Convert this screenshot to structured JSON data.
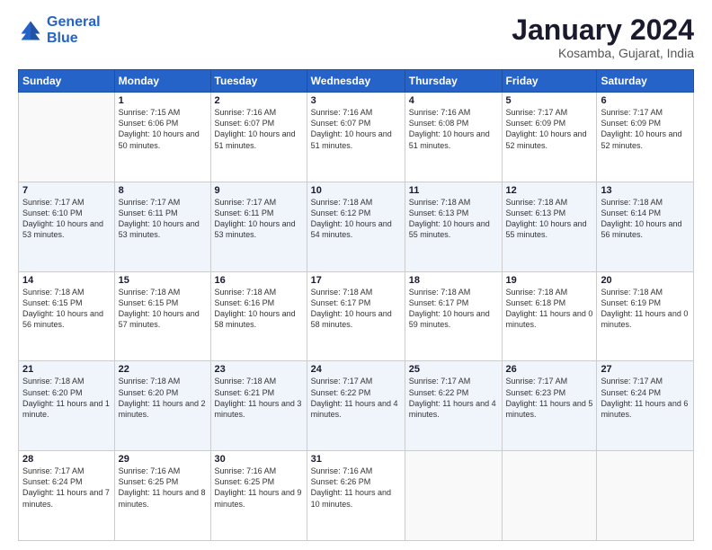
{
  "header": {
    "logo_line1": "General",
    "logo_line2": "Blue",
    "title": "January 2024",
    "location": "Kosamba, Gujarat, India"
  },
  "days_of_week": [
    "Sunday",
    "Monday",
    "Tuesday",
    "Wednesday",
    "Thursday",
    "Friday",
    "Saturday"
  ],
  "weeks": [
    [
      {
        "day": "",
        "sunrise": "",
        "sunset": "",
        "daylight": ""
      },
      {
        "day": "1",
        "sunrise": "Sunrise: 7:15 AM",
        "sunset": "Sunset: 6:06 PM",
        "daylight": "Daylight: 10 hours and 50 minutes."
      },
      {
        "day": "2",
        "sunrise": "Sunrise: 7:16 AM",
        "sunset": "Sunset: 6:07 PM",
        "daylight": "Daylight: 10 hours and 51 minutes."
      },
      {
        "day": "3",
        "sunrise": "Sunrise: 7:16 AM",
        "sunset": "Sunset: 6:07 PM",
        "daylight": "Daylight: 10 hours and 51 minutes."
      },
      {
        "day": "4",
        "sunrise": "Sunrise: 7:16 AM",
        "sunset": "Sunset: 6:08 PM",
        "daylight": "Daylight: 10 hours and 51 minutes."
      },
      {
        "day": "5",
        "sunrise": "Sunrise: 7:17 AM",
        "sunset": "Sunset: 6:09 PM",
        "daylight": "Daylight: 10 hours and 52 minutes."
      },
      {
        "day": "6",
        "sunrise": "Sunrise: 7:17 AM",
        "sunset": "Sunset: 6:09 PM",
        "daylight": "Daylight: 10 hours and 52 minutes."
      }
    ],
    [
      {
        "day": "7",
        "sunrise": "Sunrise: 7:17 AM",
        "sunset": "Sunset: 6:10 PM",
        "daylight": "Daylight: 10 hours and 53 minutes."
      },
      {
        "day": "8",
        "sunrise": "Sunrise: 7:17 AM",
        "sunset": "Sunset: 6:11 PM",
        "daylight": "Daylight: 10 hours and 53 minutes."
      },
      {
        "day": "9",
        "sunrise": "Sunrise: 7:17 AM",
        "sunset": "Sunset: 6:11 PM",
        "daylight": "Daylight: 10 hours and 53 minutes."
      },
      {
        "day": "10",
        "sunrise": "Sunrise: 7:18 AM",
        "sunset": "Sunset: 6:12 PM",
        "daylight": "Daylight: 10 hours and 54 minutes."
      },
      {
        "day": "11",
        "sunrise": "Sunrise: 7:18 AM",
        "sunset": "Sunset: 6:13 PM",
        "daylight": "Daylight: 10 hours and 55 minutes."
      },
      {
        "day": "12",
        "sunrise": "Sunrise: 7:18 AM",
        "sunset": "Sunset: 6:13 PM",
        "daylight": "Daylight: 10 hours and 55 minutes."
      },
      {
        "day": "13",
        "sunrise": "Sunrise: 7:18 AM",
        "sunset": "Sunset: 6:14 PM",
        "daylight": "Daylight: 10 hours and 56 minutes."
      }
    ],
    [
      {
        "day": "14",
        "sunrise": "Sunrise: 7:18 AM",
        "sunset": "Sunset: 6:15 PM",
        "daylight": "Daylight: 10 hours and 56 minutes."
      },
      {
        "day": "15",
        "sunrise": "Sunrise: 7:18 AM",
        "sunset": "Sunset: 6:15 PM",
        "daylight": "Daylight: 10 hours and 57 minutes."
      },
      {
        "day": "16",
        "sunrise": "Sunrise: 7:18 AM",
        "sunset": "Sunset: 6:16 PM",
        "daylight": "Daylight: 10 hours and 58 minutes."
      },
      {
        "day": "17",
        "sunrise": "Sunrise: 7:18 AM",
        "sunset": "Sunset: 6:17 PM",
        "daylight": "Daylight: 10 hours and 58 minutes."
      },
      {
        "day": "18",
        "sunrise": "Sunrise: 7:18 AM",
        "sunset": "Sunset: 6:17 PM",
        "daylight": "Daylight: 10 hours and 59 minutes."
      },
      {
        "day": "19",
        "sunrise": "Sunrise: 7:18 AM",
        "sunset": "Sunset: 6:18 PM",
        "daylight": "Daylight: 11 hours and 0 minutes."
      },
      {
        "day": "20",
        "sunrise": "Sunrise: 7:18 AM",
        "sunset": "Sunset: 6:19 PM",
        "daylight": "Daylight: 11 hours and 0 minutes."
      }
    ],
    [
      {
        "day": "21",
        "sunrise": "Sunrise: 7:18 AM",
        "sunset": "Sunset: 6:20 PM",
        "daylight": "Daylight: 11 hours and 1 minute."
      },
      {
        "day": "22",
        "sunrise": "Sunrise: 7:18 AM",
        "sunset": "Sunset: 6:20 PM",
        "daylight": "Daylight: 11 hours and 2 minutes."
      },
      {
        "day": "23",
        "sunrise": "Sunrise: 7:18 AM",
        "sunset": "Sunset: 6:21 PM",
        "daylight": "Daylight: 11 hours and 3 minutes."
      },
      {
        "day": "24",
        "sunrise": "Sunrise: 7:17 AM",
        "sunset": "Sunset: 6:22 PM",
        "daylight": "Daylight: 11 hours and 4 minutes."
      },
      {
        "day": "25",
        "sunrise": "Sunrise: 7:17 AM",
        "sunset": "Sunset: 6:22 PM",
        "daylight": "Daylight: 11 hours and 4 minutes."
      },
      {
        "day": "26",
        "sunrise": "Sunrise: 7:17 AM",
        "sunset": "Sunset: 6:23 PM",
        "daylight": "Daylight: 11 hours and 5 minutes."
      },
      {
        "day": "27",
        "sunrise": "Sunrise: 7:17 AM",
        "sunset": "Sunset: 6:24 PM",
        "daylight": "Daylight: 11 hours and 6 minutes."
      }
    ],
    [
      {
        "day": "28",
        "sunrise": "Sunrise: 7:17 AM",
        "sunset": "Sunset: 6:24 PM",
        "daylight": "Daylight: 11 hours and 7 minutes."
      },
      {
        "day": "29",
        "sunrise": "Sunrise: 7:16 AM",
        "sunset": "Sunset: 6:25 PM",
        "daylight": "Daylight: 11 hours and 8 minutes."
      },
      {
        "day": "30",
        "sunrise": "Sunrise: 7:16 AM",
        "sunset": "Sunset: 6:25 PM",
        "daylight": "Daylight: 11 hours and 9 minutes."
      },
      {
        "day": "31",
        "sunrise": "Sunrise: 7:16 AM",
        "sunset": "Sunset: 6:26 PM",
        "daylight": "Daylight: 11 hours and 10 minutes."
      },
      {
        "day": "",
        "sunrise": "",
        "sunset": "",
        "daylight": ""
      },
      {
        "day": "",
        "sunrise": "",
        "sunset": "",
        "daylight": ""
      },
      {
        "day": "",
        "sunrise": "",
        "sunset": "",
        "daylight": ""
      }
    ]
  ]
}
